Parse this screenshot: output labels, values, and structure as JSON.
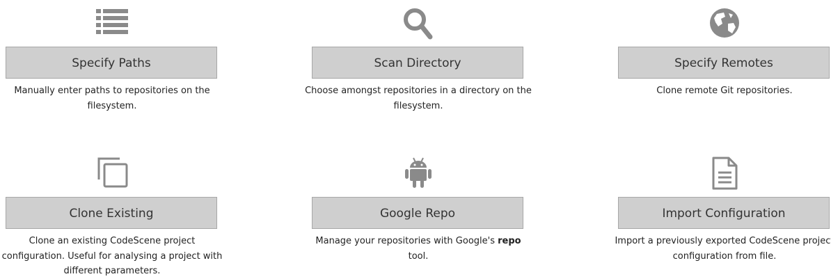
{
  "options": [
    {
      "button_label": "Specify Paths",
      "description": "Manually enter paths to repositories on the filesystem.",
      "icon": "list-icon"
    },
    {
      "button_label": "Scan Directory",
      "description": "Choose amongst repositories in a directory on the filesystem.",
      "icon": "search-icon"
    },
    {
      "button_label": "Specify Remotes",
      "description": "Clone remote Git repositories.",
      "icon": "globe-icon"
    },
    {
      "button_label": "Clone Existing",
      "description": "Clone an existing CodeScene project configuration. Useful for analysing a project with different parameters.",
      "icon": "clone-icon"
    },
    {
      "button_label": "Google Repo",
      "description_before": "Manage your repositories with Google's ",
      "description_bold": "repo",
      "description_after": " tool.",
      "icon": "android-icon"
    },
    {
      "button_label": "Import Configuration",
      "description": "Import a previously exported CodeScene project configuration from file.",
      "icon": "file-text-icon"
    }
  ],
  "colors": {
    "icon": "#8a8a8a",
    "button_bg": "#cfcfcf",
    "button_border": "#a7a7a7",
    "text": "#222222"
  }
}
